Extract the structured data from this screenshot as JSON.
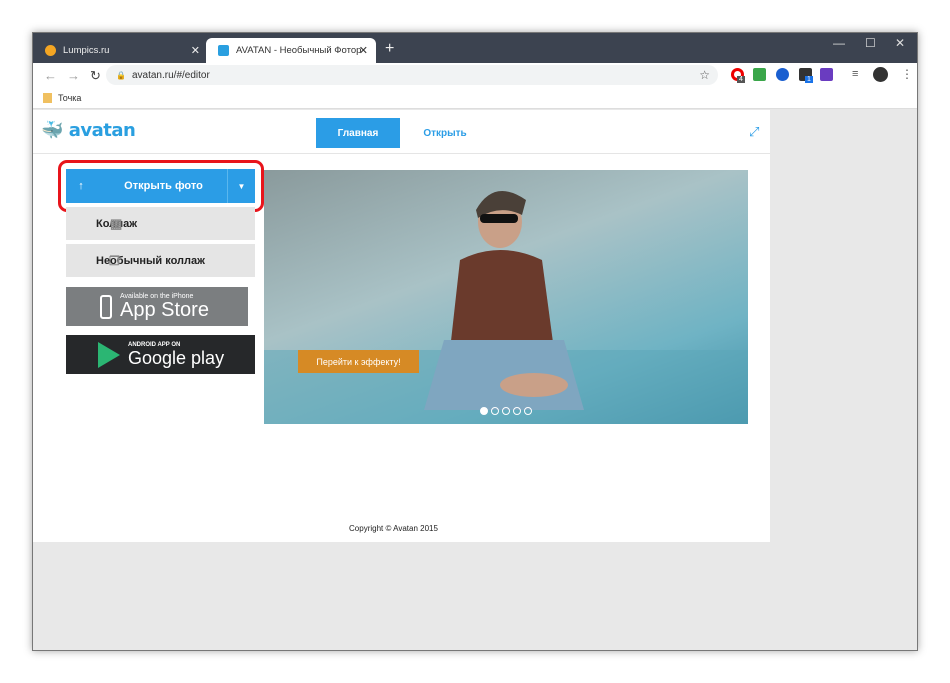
{
  "browser": {
    "tabs": [
      {
        "title": "Lumpics.ru",
        "favicon_color": "#f5a623"
      },
      {
        "title": "AVATAN - Необычный Фоторед",
        "favicon_color": "#2a9fe0"
      }
    ],
    "new_tab": "+",
    "url": "avatan.ru/#/editor",
    "bookmarks": [
      {
        "label": "Точка"
      }
    ],
    "extension_badges": [
      "4",
      "1"
    ],
    "window_controls": [
      "minimize",
      "maximize",
      "close"
    ]
  },
  "site": {
    "logo": "avatan",
    "nav": [
      {
        "label": "Главная",
        "active": true
      },
      {
        "label": "Открыть",
        "active": false
      }
    ],
    "open_photo": "Открыть фото",
    "collage": "Коллаж",
    "unusual_collage": "Необычный коллаж",
    "appstore": {
      "small": "Available on the iPhone",
      "big": "App Store"
    },
    "googleplay": {
      "small": "ANDROID APP ON",
      "big": "Google play"
    },
    "hero_button": "Перейти к эффекту!",
    "carousel": {
      "count": 5,
      "active": 0
    },
    "copyright": "Copyright © Avatan 2015"
  },
  "colors": {
    "accent": "#2b9de6",
    "highlight": "#e8141b",
    "hero_button": "#d68a25"
  }
}
